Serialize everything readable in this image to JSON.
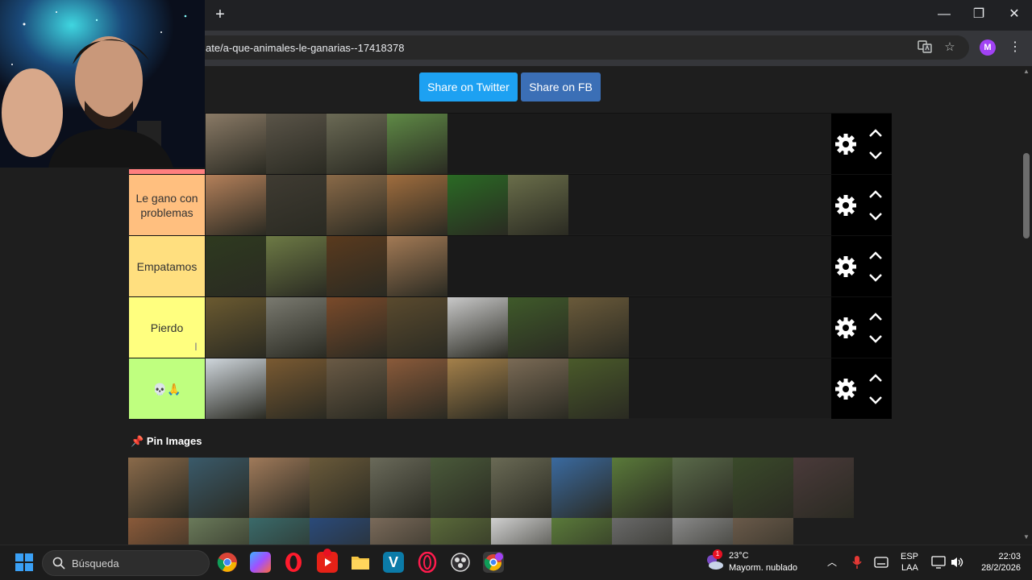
{
  "browser": {
    "url": "ate/a-que-animales-le-ganarias--17418378",
    "profile_initial": "M",
    "new_tab_label": "+",
    "minimize_label": "—",
    "restore_label": "❐",
    "close_label": "✕"
  },
  "share": {
    "twitter_label": "Share on Twitter",
    "facebook_label": "Share on FB"
  },
  "tiers": [
    {
      "label": "",
      "color": "#ff7f7f",
      "item_count": 4,
      "colors": [
        "#8a7a66",
        "#5a5448",
        "#6b6a55",
        "#5f8a46"
      ]
    },
    {
      "label": "Le gano con problemas",
      "color": "#ffbf7f",
      "item_count": 6,
      "colors": [
        "#b4805a",
        "#3f3b32",
        "#8a6a48",
        "#a06d3e",
        "#2a6a24",
        "#6a6e4a"
      ]
    },
    {
      "label": "Empatamos",
      "color": "#ffdf7f",
      "item_count": 4,
      "colors": [
        "#2e3a1f",
        "#6d7a45",
        "#5a3a1e",
        "#a37a55"
      ]
    },
    {
      "label": "Pierdo",
      "color": "#ffff7f",
      "item_count": 7,
      "colors": [
        "#6b5a30",
        "#7a7a70",
        "#7a4a2a",
        "#5a4a2e",
        "#c8c8c8",
        "#3f5a2a",
        "#6a5a3a"
      ]
    },
    {
      "label": "💀🙏",
      "color": "#bfff7f",
      "item_count": 7,
      "colors": [
        "#cfd6dc",
        "#7a5a32",
        "#6a5a45",
        "#8a5a3a",
        "#a4804a",
        "#7a6a55",
        "#4a5a2a"
      ]
    }
  ],
  "pin_section": {
    "title": "Pin Images",
    "row1_colors": [
      "#8a6a4a",
      "#3a5a6a",
      "#a07a5a",
      "#6a5a3a",
      "#6a6a5a",
      "#4a5a3a",
      "#6a6a55",
      "#3a6aa0",
      "#5a7a3a",
      "#5a6a4a",
      "#3a4a2a",
      "#4a3a3a"
    ],
    "row2_colors": [
      "#8a5a3a",
      "#6a7a5a",
      "#3a6a6a",
      "#2a4a7a",
      "#7a6a5a",
      "#5a6a3a",
      "#d0d0d0",
      "#5a7a3a",
      "#6a6a6a",
      "#8a8a8a",
      "#6a5a4a"
    ]
  },
  "taskbar": {
    "search_label": "Búsqueda",
    "weather_temp": "23°C",
    "weather_desc": "Mayorm. nublado",
    "lang_top": "ESP",
    "lang_bottom": "LAA",
    "time": "22:03",
    "date": "28/2/2026",
    "notification_badge": "1"
  }
}
